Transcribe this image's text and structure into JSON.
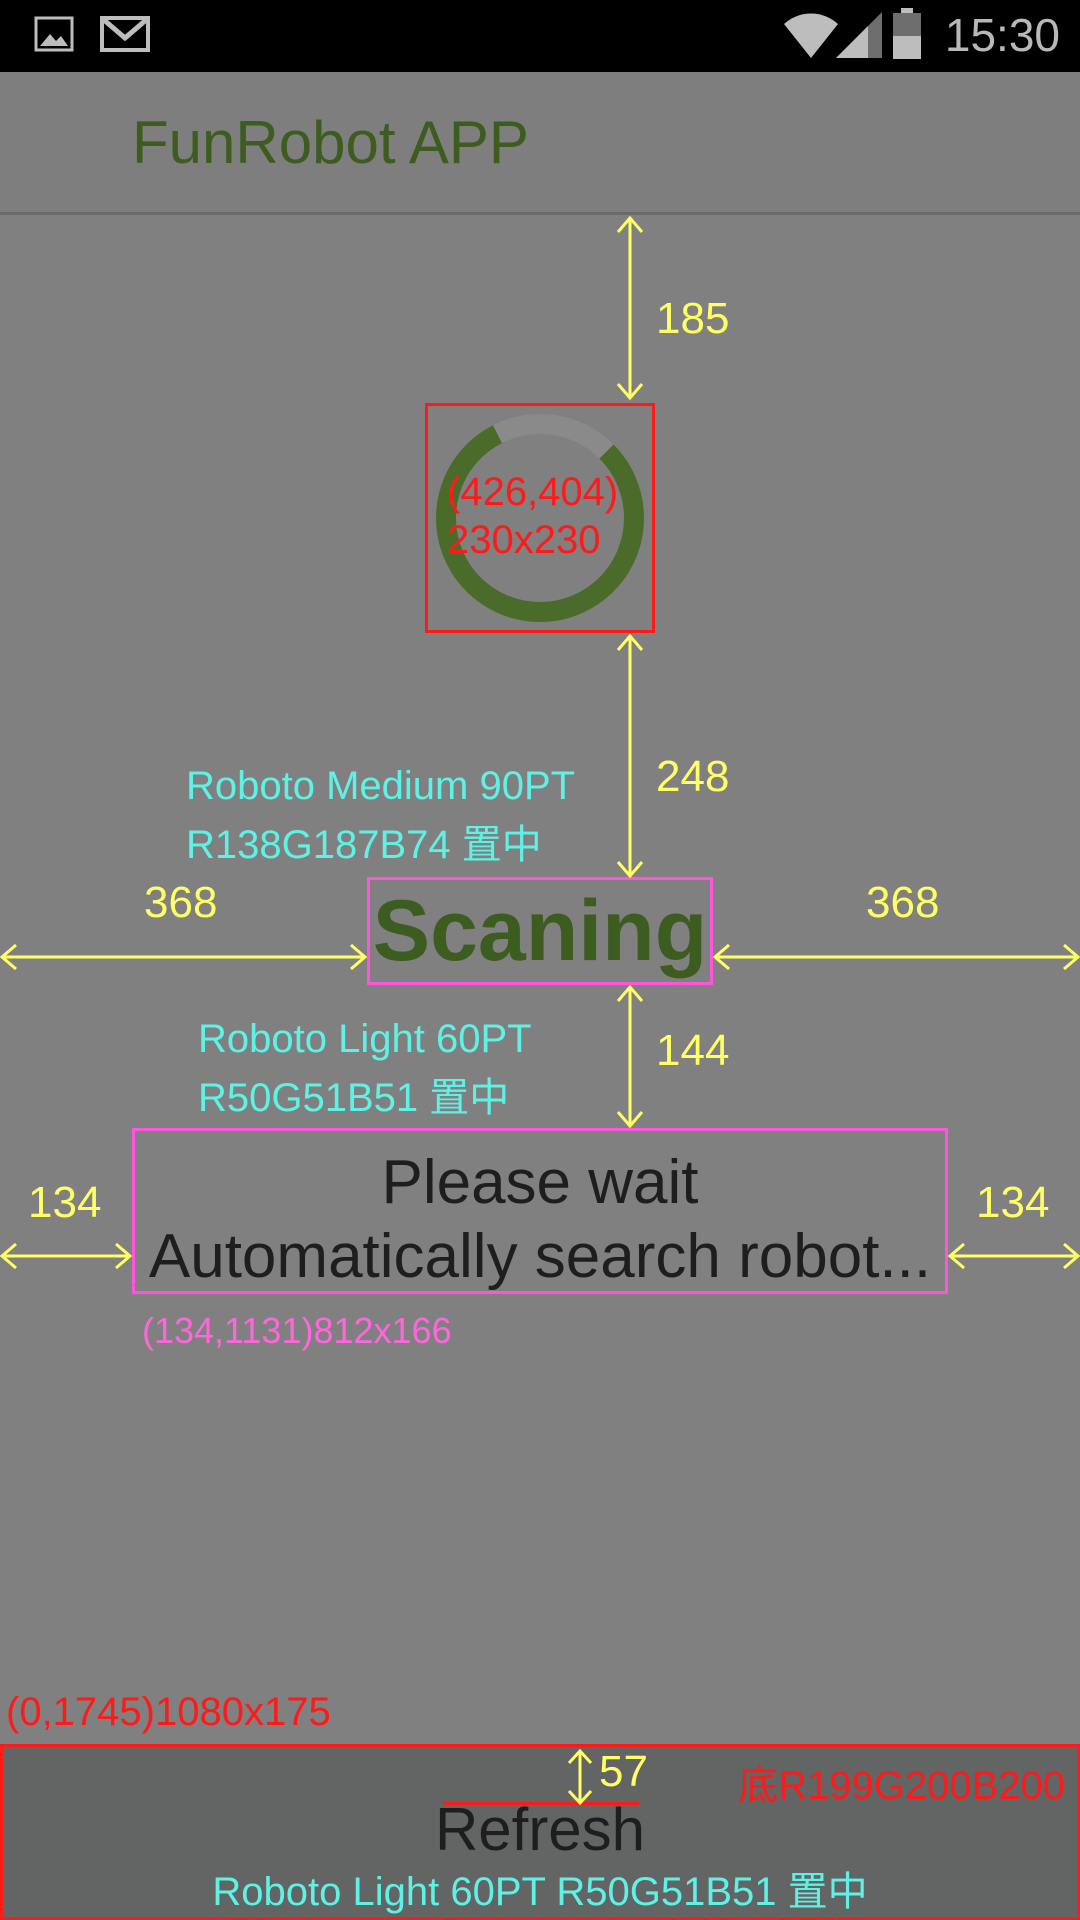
{
  "status_bar": {
    "time": "15:30",
    "left_icons": [
      "image-icon",
      "gmail-icon"
    ],
    "right_icons": [
      "wifi-icon",
      "signal-icon",
      "battery-icon"
    ]
  },
  "app_bar": {
    "title": "FunRobot APP"
  },
  "spinner": {
    "coords_label": "(426,404)",
    "size_label": "230x230",
    "progress_fraction": 0.8,
    "color": "#4a6b2a"
  },
  "scanning": {
    "title": "Scaning",
    "spec_font": "Roboto Medium 90PT",
    "spec_color": "R138G187B74 置中"
  },
  "wait": {
    "line1": "Please wait",
    "line2": "Automatically search robot...",
    "spec_font": "Roboto Light 60PT",
    "spec_color": "R50G51B51 置中",
    "box_label": "(134,1131)812x166"
  },
  "measurements": {
    "top_gap": "185",
    "spinner_to_title": "248",
    "title_left": "368",
    "title_right": "368",
    "title_to_wait": "144",
    "wait_left": "134",
    "wait_right": "134",
    "refresh_top": "57"
  },
  "bottom_bar": {
    "label": "Refresh",
    "box_label": "(0,1745)1080x175",
    "bg_spec": "底R199G200B200",
    "spec": "Roboto Light 60PT R50G51B51 置中"
  },
  "colors": {
    "background": "#808080",
    "title_green": "#3d5c1f",
    "annotation_yellow": "#ffff66",
    "annotation_cyan": "#5ef2e6",
    "annotation_red": "#ff1a1a",
    "annotation_magenta": "#ff55dd"
  }
}
